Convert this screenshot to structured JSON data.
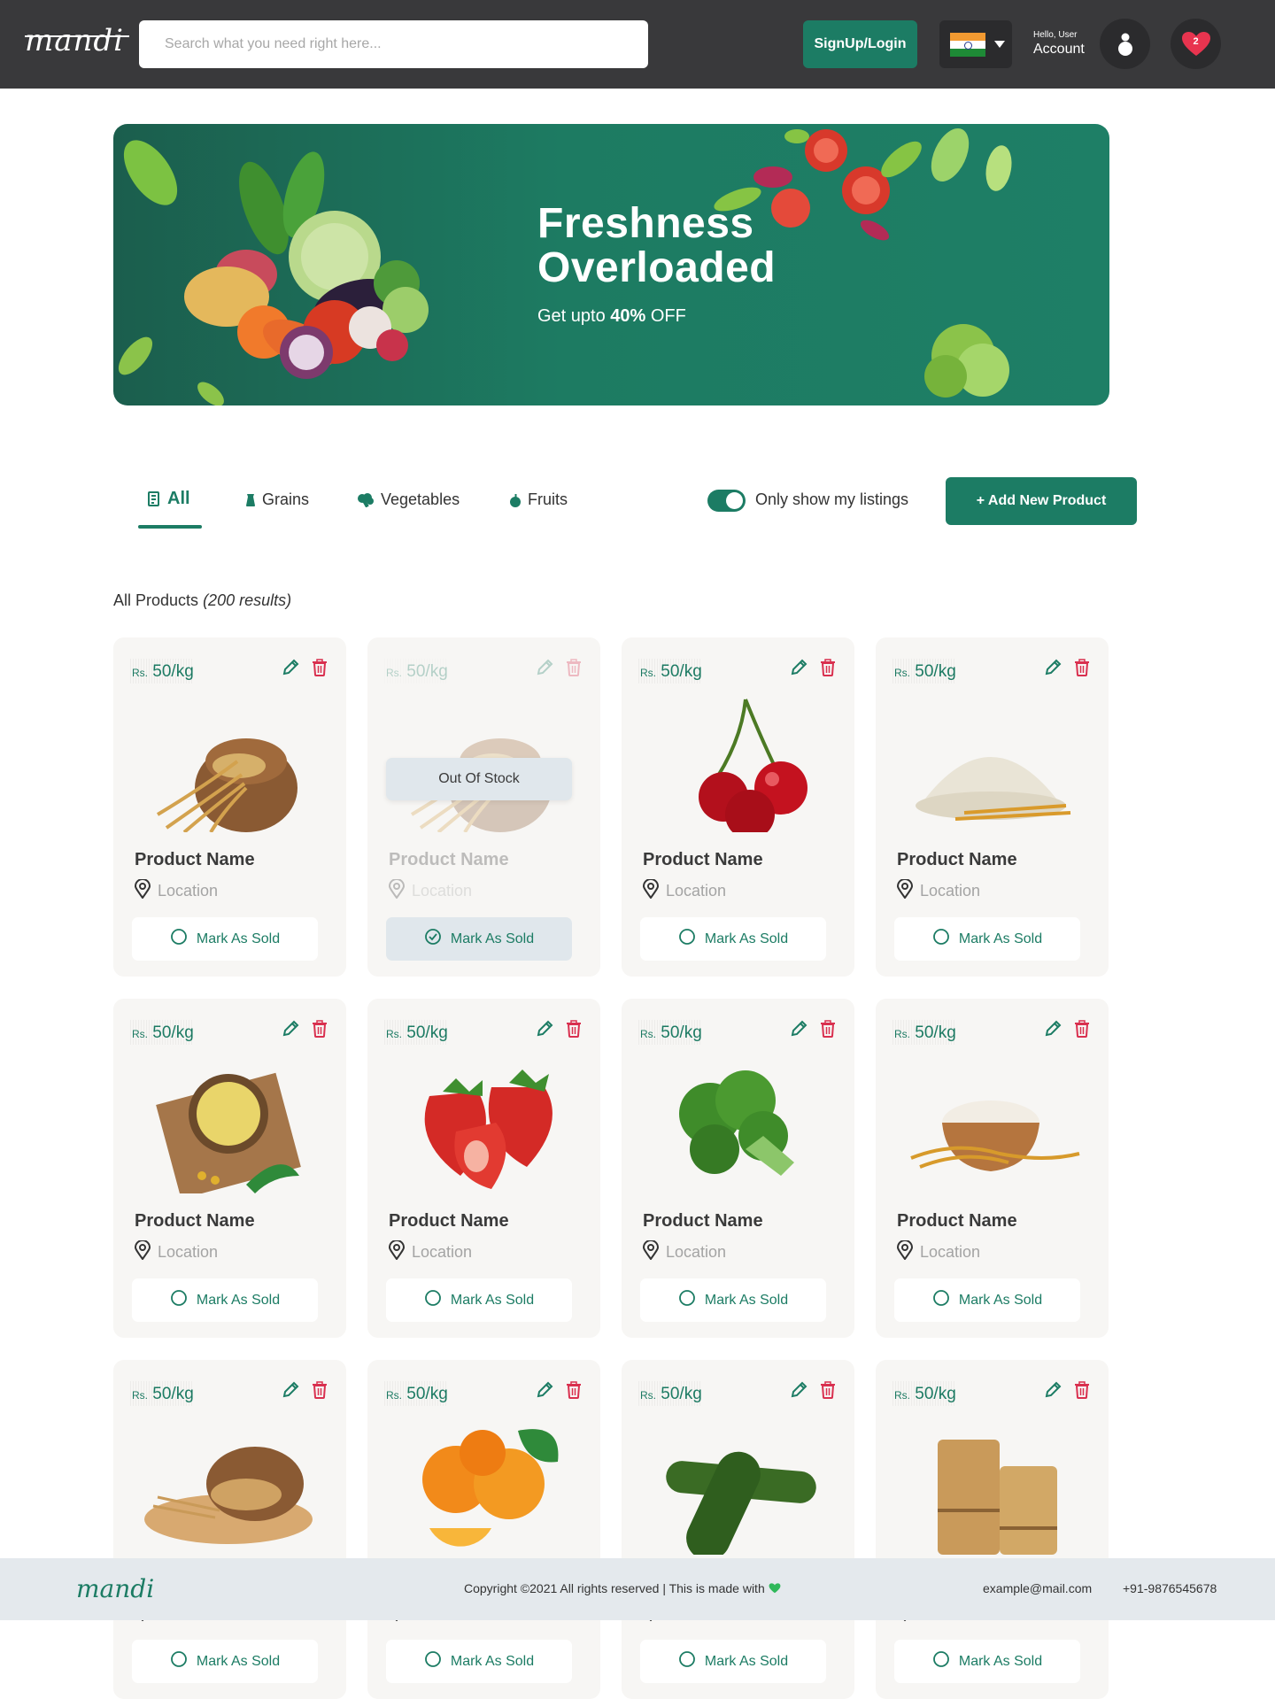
{
  "header": {
    "logo": "mandi",
    "search_placeholder": "Search what you need right here...",
    "signup_label": "SignUp/Login",
    "greeting": "Hello, User",
    "account_label": "Account",
    "wishlist_count": "2"
  },
  "banner": {
    "title_line1": "Freshness",
    "title_line2": "Overloaded",
    "sub_prefix": "Get upto",
    "sub_bold": "40%",
    "sub_suffix": "OFF"
  },
  "tabs": [
    {
      "label": "All",
      "icon": "list-icon"
    },
    {
      "label": "Grains",
      "icon": "grain-sack-icon"
    },
    {
      "label": "Vegetables",
      "icon": "broccoli-icon"
    },
    {
      "label": "Fruits",
      "icon": "apple-icon"
    }
  ],
  "filter": {
    "toggle_label": "Only show my listings",
    "toggle_on": true,
    "add_button": "+ Add New Product"
  },
  "results": {
    "label": "All Products",
    "count": "(200 results)"
  },
  "product_common": {
    "currency": "Rs.",
    "name": "Product Name",
    "location": "Location",
    "mark_sold": "Mark As Sold",
    "out_of_stock": "Out Of Stock"
  },
  "products": [
    {
      "price": "50/kg",
      "item": "wheat-sack",
      "out_of_stock": false
    },
    {
      "price": "50/kg",
      "item": "wheat-sack",
      "out_of_stock": true
    },
    {
      "price": "50/kg",
      "item": "cherries",
      "out_of_stock": false
    },
    {
      "price": "50/kg",
      "item": "flour",
      "out_of_stock": false
    },
    {
      "price": "50/kg",
      "item": "cornmeal",
      "out_of_stock": false
    },
    {
      "price": "50/kg",
      "item": "strawberries",
      "out_of_stock": false
    },
    {
      "price": "50/kg",
      "item": "broccoli",
      "out_of_stock": false
    },
    {
      "price": "50/kg",
      "item": "rice-flour",
      "out_of_stock": false
    },
    {
      "price": "50/kg",
      "item": "wheat-grains",
      "out_of_stock": false
    },
    {
      "price": "50/kg",
      "item": "oranges",
      "out_of_stock": false
    },
    {
      "price": "50/kg",
      "item": "cucumbers",
      "out_of_stock": false
    },
    {
      "price": "50/kg",
      "item": "wheat-bundles",
      "out_of_stock": false
    }
  ],
  "footer": {
    "logo": "mandi",
    "copyright": "Copyright ©2021 All rights reserved | This is made with",
    "email": "example@mail.com",
    "phone": "+91-9876545678"
  },
  "colors": {
    "accent": "#1c7c64",
    "header_bg": "#39393b",
    "delete": "#d9304f",
    "card_bg": "#f7f6f4"
  }
}
